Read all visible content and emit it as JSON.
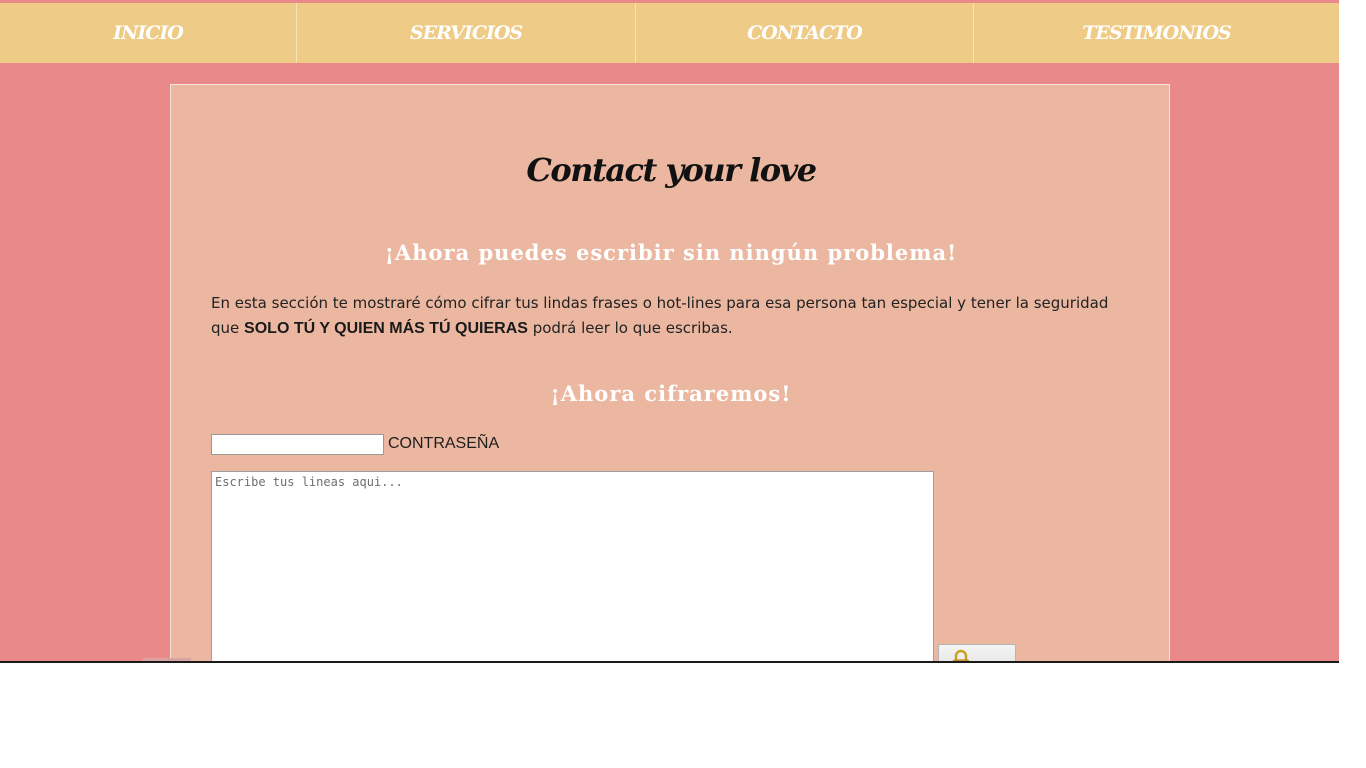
{
  "nav": {
    "items": [
      {
        "label": "INICIO"
      },
      {
        "label": "SERVICIOS"
      },
      {
        "label": "CONTACTO"
      },
      {
        "label": "TESTIMONIOS"
      }
    ]
  },
  "main": {
    "title": "Contact your love",
    "subtitle_1": "¡Ahora puedes escribir sin ningún problema!",
    "intro_text": "En esta sección te mostraré cómo cifrar tus lindas frases o hot-lines para esa persona tan especial y tener la seguridad que",
    "intro_emphasis": "SOLO TÚ Y QUIEN MÁS TÚ QUIERAS",
    "intro_tail": "podrá leer lo que escribas.",
    "subtitle_2": "¡Ahora cifraremos!",
    "password": {
      "label": "CONTRASEÑA",
      "value": "",
      "placeholder": ""
    },
    "message": {
      "value": "",
      "placeholder": "Escribe tus lineas aqui..."
    },
    "encrypt_button": {
      "icon": "lock-icon"
    }
  },
  "colors": {
    "background": "#ea898a",
    "nav_background": "#eecb86",
    "panel_background": "#ebb7a1",
    "nav_text": "#ffffff",
    "subtitle_text": "#ffffff",
    "body_text": "#222222"
  }
}
